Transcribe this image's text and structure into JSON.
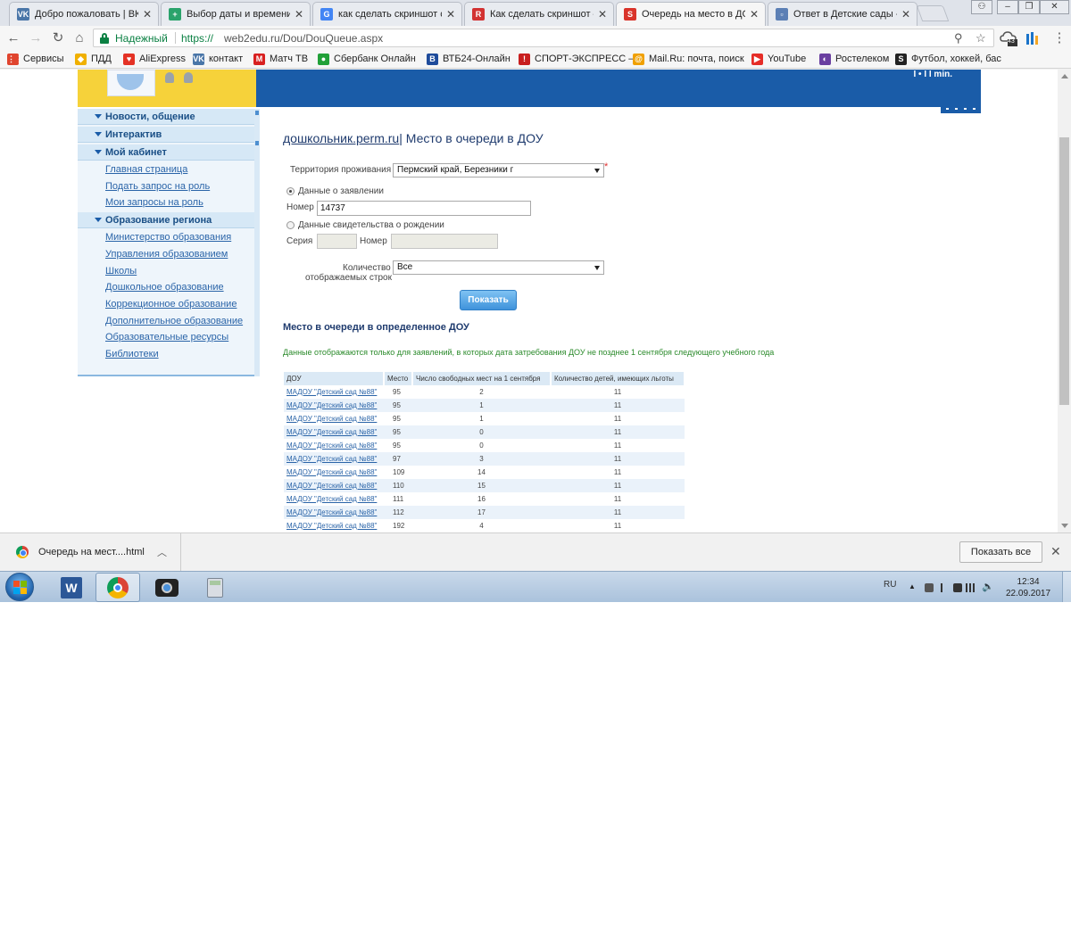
{
  "browser": {
    "tabs": [
      {
        "title": "Добро пожаловать | ВКо",
        "icon": "vk-icon",
        "color": "#4a76a8",
        "glyph": "VK"
      },
      {
        "title": "Выбор даты и времени",
        "icon": "calendar-plus-icon",
        "color": "#2aa36b",
        "glyph": "+"
      },
      {
        "title": "как сделать скриншот с",
        "icon": "google-icon",
        "color": "#4285f4",
        "glyph": "G"
      },
      {
        "title": "Как сделать скриншот –",
        "icon": "site-icon",
        "color": "#d23232",
        "glyph": "R"
      },
      {
        "title": "Очередь на место в ДО",
        "icon": "site-s-icon",
        "color": "#d9342b",
        "glyph": "S",
        "active": true
      },
      {
        "title": "Ответ в Детские сады -",
        "icon": "page-icon",
        "color": "#5b7fb5",
        "glyph": "▫"
      }
    ],
    "secure_label": "Надежный",
    "url_scheme": "https://",
    "url_rest": "web2edu.ru/Dou/DouQueue.aspx",
    "ext_badge": "43",
    "bookmarks": [
      {
        "label": "Сервисы",
        "icon": "apps-grid-icon",
        "color": "#e0442e"
      },
      {
        "label": "ПДД",
        "icon": "road-sign-icon",
        "color": "#f0b000"
      },
      {
        "label": "AliExpress",
        "icon": "aliexpress-icon",
        "color": "#e43225"
      },
      {
        "label": "контакт",
        "icon": "vk-icon",
        "color": "#4a76a8"
      },
      {
        "label": "Матч ТВ",
        "icon": "match-tv-icon",
        "color": "#d82020"
      },
      {
        "label": "Сбербанк Онлайн",
        "icon": "sberbank-icon",
        "color": "#21a038"
      },
      {
        "label": "ВТБ24-Онлайн",
        "icon": "vtb-icon",
        "color": "#1e4b9b"
      },
      {
        "label": "СПОРТ-ЭКСПРЕСС –",
        "icon": "sport-express-icon",
        "color": "#c81e1e"
      },
      {
        "label": "Mail.Ru: почта, поиск",
        "icon": "mailru-icon",
        "color": "#f0a000"
      },
      {
        "label": "YouTube",
        "icon": "youtube-icon",
        "color": "#e52d27"
      },
      {
        "label": "Ростелеком",
        "icon": "rostelecom-icon",
        "color": "#6a3fa0"
      },
      {
        "label": "Футбол, хоккей, бас",
        "icon": "sports-s-icon",
        "color": "#222222"
      }
    ]
  },
  "site": {
    "banner_text": "I • I I min.",
    "menu": [
      {
        "type": "head",
        "label": "Новости, общение"
      },
      {
        "type": "head",
        "label": "Интерактив"
      },
      {
        "type": "head",
        "label": "Мой кабинет"
      },
      {
        "type": "link",
        "label": "Главная страница"
      },
      {
        "type": "link",
        "label": "Подать запрос на роль"
      },
      {
        "type": "link",
        "label": "Мои запросы на роль"
      },
      {
        "type": "head",
        "label": "Образование региона"
      },
      {
        "type": "link",
        "label": "Министерство образования"
      },
      {
        "type": "link",
        "label": "Управления образованием"
      },
      {
        "type": "link",
        "label": "Школы"
      },
      {
        "type": "link",
        "label": "Дошкольное образование"
      },
      {
        "type": "link",
        "label": "Коррекционное образование"
      },
      {
        "type": "link",
        "label": "Дополнительное образование"
      },
      {
        "type": "link",
        "label": "Образовательные ресурсы"
      },
      {
        "type": "link",
        "label": "Библиотеки"
      }
    ]
  },
  "form": {
    "crumb_link": "дошкольник.perm.ru",
    "crumb_title": "| Место в очереди в ДОУ",
    "territory_label": "Территория проживания",
    "territory_value": "Пермский край, Березники г",
    "required_mark": "*",
    "radio_application_label": "Данные о заявлении",
    "number_label": "Номер",
    "number_value": "14737",
    "radio_birth_label": "Данные свидетельства о рождении",
    "series_label": "Серия",
    "number2_label": "Номер",
    "rows_label_1": "Количество",
    "rows_label_2": "отображаемых строк",
    "rows_value": "Все",
    "show_button": "Показать"
  },
  "results": {
    "heading": "Место в очереди в определенное ДОУ",
    "note": "Данные отображаются только для заявлений, в которых дата затребования ДОУ не позднее 1 сентября следующего учебного года",
    "columns": [
      "ДОУ",
      "Место",
      "Число свободных мест на 1 сентября",
      "Количество детей, имеющих льготы"
    ],
    "rows": [
      {
        "dou": "МАДОУ \"Детский сад №88\"",
        "place": "95",
        "free": "2",
        "benefit": "11"
      },
      {
        "dou": "МАДОУ \"Детский сад №88\"",
        "place": "95",
        "free": "1",
        "benefit": "11"
      },
      {
        "dou": "МАДОУ \"Детский сад №88\"",
        "place": "95",
        "free": "1",
        "benefit": "11"
      },
      {
        "dou": "МАДОУ \"Детский сад №88\"",
        "place": "95",
        "free": "0",
        "benefit": "11"
      },
      {
        "dou": "МАДОУ \"Детский сад №88\"",
        "place": "95",
        "free": "0",
        "benefit": "11"
      },
      {
        "dou": "МАДОУ \"Детский сад №88\"",
        "place": "97",
        "free": "3",
        "benefit": "11"
      },
      {
        "dou": "МАДОУ \"Детский сад №88\"",
        "place": "109",
        "free": "14",
        "benefit": "11"
      },
      {
        "dou": "МАДОУ \"Детский сад №88\"",
        "place": "110",
        "free": "15",
        "benefit": "11"
      },
      {
        "dou": "МАДОУ \"Детский сад №88\"",
        "place": "111",
        "free": "16",
        "benefit": "11"
      },
      {
        "dou": "МАДОУ \"Детский сад №88\"",
        "place": "112",
        "free": "17",
        "benefit": "11"
      },
      {
        "dou": "МАДОУ \"Детский сад №88\"",
        "place": "192",
        "free": "4",
        "benefit": "11"
      }
    ]
  },
  "downloads": {
    "file_name": "Очередь на мест....html",
    "show_all": "Показать все"
  },
  "taskbar": {
    "lang": "RU",
    "time": "12:34",
    "date": "22.09.2017"
  }
}
